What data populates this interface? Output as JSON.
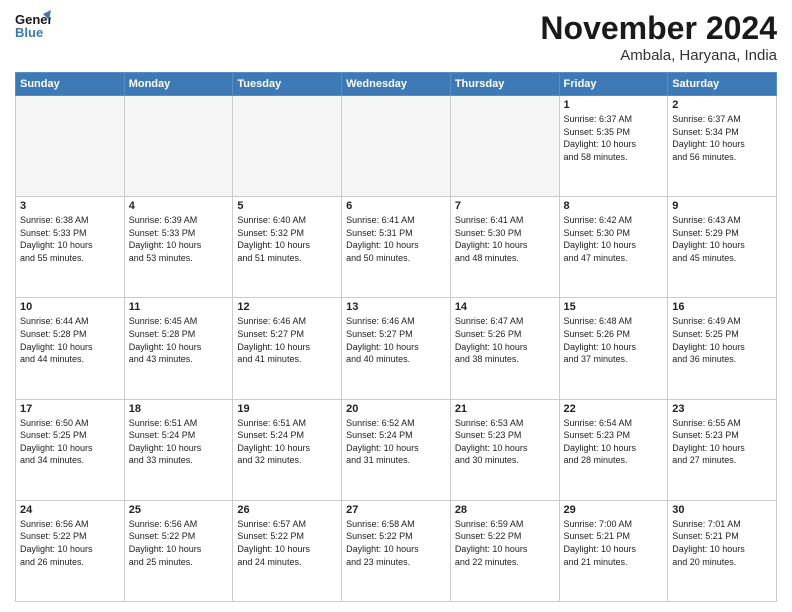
{
  "header": {
    "logo_line1": "General",
    "logo_line2": "Blue",
    "month": "November 2024",
    "location": "Ambala, Haryana, India"
  },
  "weekdays": [
    "Sunday",
    "Monday",
    "Tuesday",
    "Wednesday",
    "Thursday",
    "Friday",
    "Saturday"
  ],
  "weeks": [
    [
      {
        "day": "",
        "info": "",
        "empty": true
      },
      {
        "day": "",
        "info": "",
        "empty": true
      },
      {
        "day": "",
        "info": "",
        "empty": true
      },
      {
        "day": "",
        "info": "",
        "empty": true
      },
      {
        "day": "",
        "info": "",
        "empty": true
      },
      {
        "day": "1",
        "info": "Sunrise: 6:37 AM\nSunset: 5:35 PM\nDaylight: 10 hours\nand 58 minutes.",
        "empty": false
      },
      {
        "day": "2",
        "info": "Sunrise: 6:37 AM\nSunset: 5:34 PM\nDaylight: 10 hours\nand 56 minutes.",
        "empty": false
      }
    ],
    [
      {
        "day": "3",
        "info": "Sunrise: 6:38 AM\nSunset: 5:33 PM\nDaylight: 10 hours\nand 55 minutes.",
        "empty": false
      },
      {
        "day": "4",
        "info": "Sunrise: 6:39 AM\nSunset: 5:33 PM\nDaylight: 10 hours\nand 53 minutes.",
        "empty": false
      },
      {
        "day": "5",
        "info": "Sunrise: 6:40 AM\nSunset: 5:32 PM\nDaylight: 10 hours\nand 51 minutes.",
        "empty": false
      },
      {
        "day": "6",
        "info": "Sunrise: 6:41 AM\nSunset: 5:31 PM\nDaylight: 10 hours\nand 50 minutes.",
        "empty": false
      },
      {
        "day": "7",
        "info": "Sunrise: 6:41 AM\nSunset: 5:30 PM\nDaylight: 10 hours\nand 48 minutes.",
        "empty": false
      },
      {
        "day": "8",
        "info": "Sunrise: 6:42 AM\nSunset: 5:30 PM\nDaylight: 10 hours\nand 47 minutes.",
        "empty": false
      },
      {
        "day": "9",
        "info": "Sunrise: 6:43 AM\nSunset: 5:29 PM\nDaylight: 10 hours\nand 45 minutes.",
        "empty": false
      }
    ],
    [
      {
        "day": "10",
        "info": "Sunrise: 6:44 AM\nSunset: 5:28 PM\nDaylight: 10 hours\nand 44 minutes.",
        "empty": false
      },
      {
        "day": "11",
        "info": "Sunrise: 6:45 AM\nSunset: 5:28 PM\nDaylight: 10 hours\nand 43 minutes.",
        "empty": false
      },
      {
        "day": "12",
        "info": "Sunrise: 6:46 AM\nSunset: 5:27 PM\nDaylight: 10 hours\nand 41 minutes.",
        "empty": false
      },
      {
        "day": "13",
        "info": "Sunrise: 6:46 AM\nSunset: 5:27 PM\nDaylight: 10 hours\nand 40 minutes.",
        "empty": false
      },
      {
        "day": "14",
        "info": "Sunrise: 6:47 AM\nSunset: 5:26 PM\nDaylight: 10 hours\nand 38 minutes.",
        "empty": false
      },
      {
        "day": "15",
        "info": "Sunrise: 6:48 AM\nSunset: 5:26 PM\nDaylight: 10 hours\nand 37 minutes.",
        "empty": false
      },
      {
        "day": "16",
        "info": "Sunrise: 6:49 AM\nSunset: 5:25 PM\nDaylight: 10 hours\nand 36 minutes.",
        "empty": false
      }
    ],
    [
      {
        "day": "17",
        "info": "Sunrise: 6:50 AM\nSunset: 5:25 PM\nDaylight: 10 hours\nand 34 minutes.",
        "empty": false
      },
      {
        "day": "18",
        "info": "Sunrise: 6:51 AM\nSunset: 5:24 PM\nDaylight: 10 hours\nand 33 minutes.",
        "empty": false
      },
      {
        "day": "19",
        "info": "Sunrise: 6:51 AM\nSunset: 5:24 PM\nDaylight: 10 hours\nand 32 minutes.",
        "empty": false
      },
      {
        "day": "20",
        "info": "Sunrise: 6:52 AM\nSunset: 5:24 PM\nDaylight: 10 hours\nand 31 minutes.",
        "empty": false
      },
      {
        "day": "21",
        "info": "Sunrise: 6:53 AM\nSunset: 5:23 PM\nDaylight: 10 hours\nand 30 minutes.",
        "empty": false
      },
      {
        "day": "22",
        "info": "Sunrise: 6:54 AM\nSunset: 5:23 PM\nDaylight: 10 hours\nand 28 minutes.",
        "empty": false
      },
      {
        "day": "23",
        "info": "Sunrise: 6:55 AM\nSunset: 5:23 PM\nDaylight: 10 hours\nand 27 minutes.",
        "empty": false
      }
    ],
    [
      {
        "day": "24",
        "info": "Sunrise: 6:56 AM\nSunset: 5:22 PM\nDaylight: 10 hours\nand 26 minutes.",
        "empty": false
      },
      {
        "day": "25",
        "info": "Sunrise: 6:56 AM\nSunset: 5:22 PM\nDaylight: 10 hours\nand 25 minutes.",
        "empty": false
      },
      {
        "day": "26",
        "info": "Sunrise: 6:57 AM\nSunset: 5:22 PM\nDaylight: 10 hours\nand 24 minutes.",
        "empty": false
      },
      {
        "day": "27",
        "info": "Sunrise: 6:58 AM\nSunset: 5:22 PM\nDaylight: 10 hours\nand 23 minutes.",
        "empty": false
      },
      {
        "day": "28",
        "info": "Sunrise: 6:59 AM\nSunset: 5:22 PM\nDaylight: 10 hours\nand 22 minutes.",
        "empty": false
      },
      {
        "day": "29",
        "info": "Sunrise: 7:00 AM\nSunset: 5:21 PM\nDaylight: 10 hours\nand 21 minutes.",
        "empty": false
      },
      {
        "day": "30",
        "info": "Sunrise: 7:01 AM\nSunset: 5:21 PM\nDaylight: 10 hours\nand 20 minutes.",
        "empty": false
      }
    ]
  ]
}
